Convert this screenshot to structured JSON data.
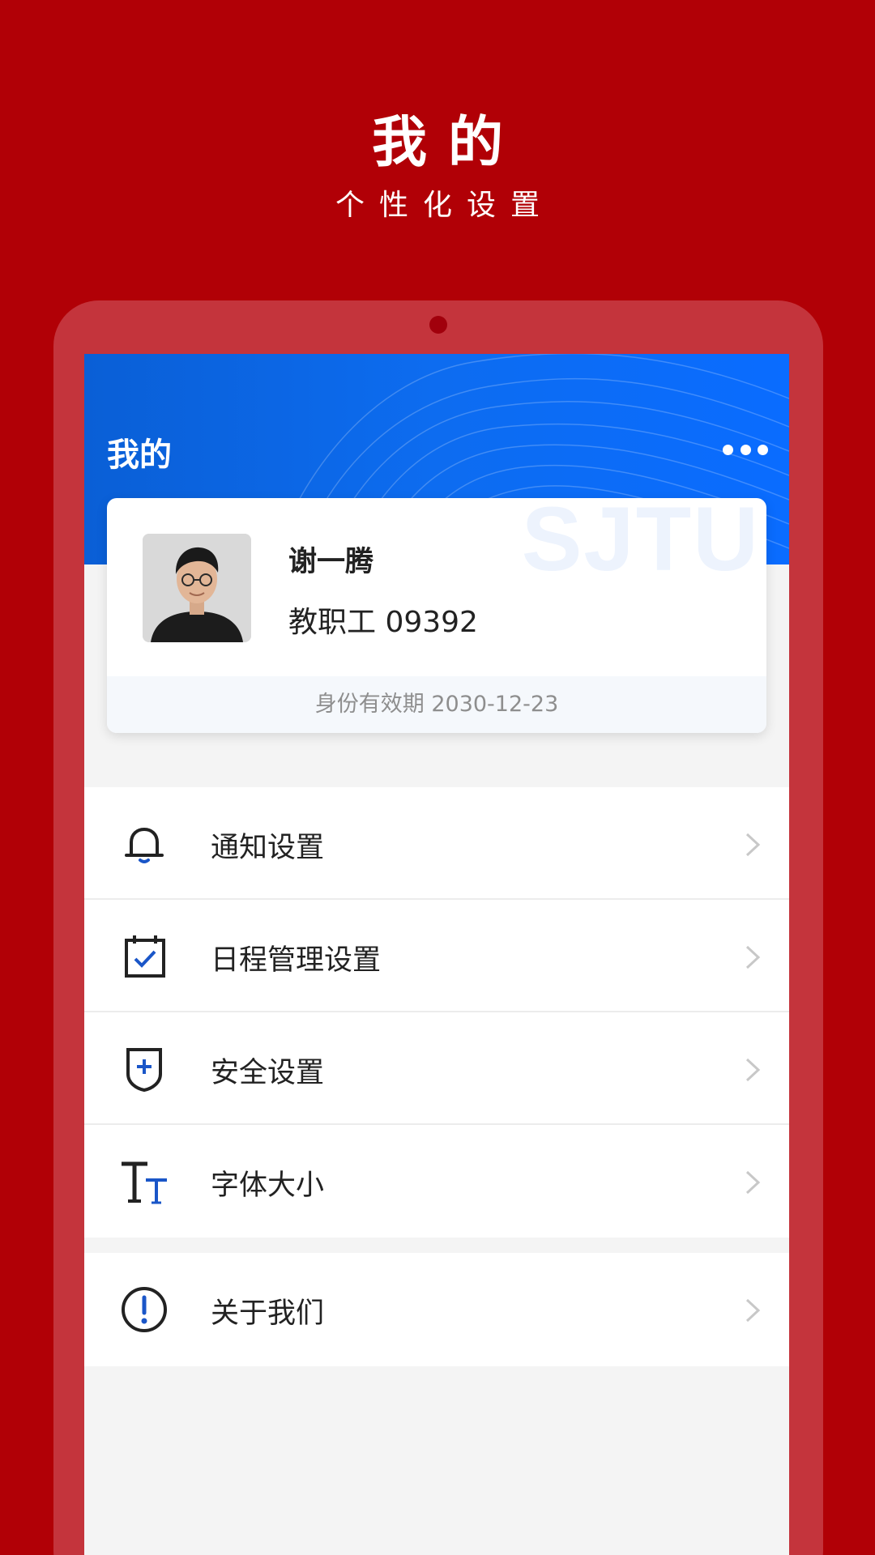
{
  "promo": {
    "title": "我的",
    "subtitle": "个性化设置"
  },
  "header": {
    "title": "我的",
    "more_icon": "more-horizontal-icon"
  },
  "profile": {
    "watermark": "SJTU",
    "name": "谢一腾",
    "role": "教职工 09392",
    "validity": "身份有效期 2030-12-23"
  },
  "menu": {
    "items": [
      {
        "label": "通知设置",
        "icon": "bell-icon"
      },
      {
        "label": "日程管理设置",
        "icon": "calendar-check-icon"
      },
      {
        "label": "安全设置",
        "icon": "shield-plus-icon"
      },
      {
        "label": "字体大小",
        "icon": "font-size-icon"
      }
    ],
    "about": {
      "label": "关于我们",
      "icon": "info-exclamation-icon"
    }
  },
  "colors": {
    "background_red": "#b10006",
    "device_red": "#c4343c",
    "header_blue": "#0d6cf0",
    "icon_accent_blue": "#1a56c8"
  }
}
